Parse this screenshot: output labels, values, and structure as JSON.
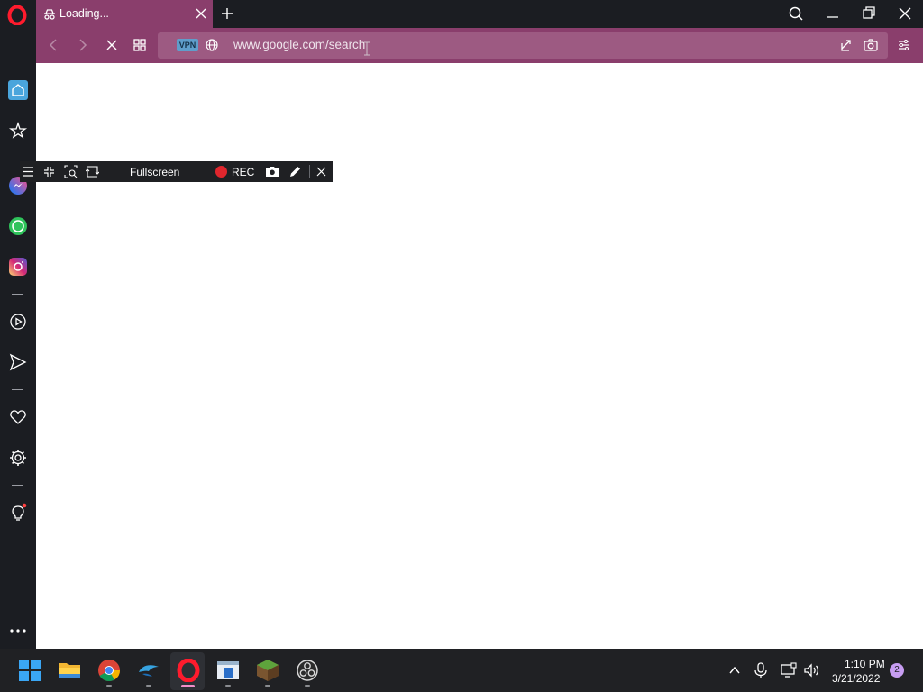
{
  "browser": {
    "tab": {
      "title": "Loading...",
      "icon": "incognito-icon"
    },
    "address": {
      "url": "www.google.com/search",
      "vpn_label": "VPN"
    },
    "window_controls": [
      "search-icon",
      "minimize-icon",
      "restore-icon",
      "close-icon"
    ],
    "nav": [
      "back-icon",
      "forward-icon",
      "stop-icon",
      "speed-dial-icon"
    ]
  },
  "sidebar": {
    "items": [
      "home-icon",
      "star-icon",
      "messenger-icon",
      "whatsapp-icon",
      "instagram-icon",
      "player-icon",
      "send-icon",
      "heart-icon",
      "settings-icon",
      "lightbulb-icon",
      "more-icon"
    ]
  },
  "capture_toolbar": {
    "fullscreen_label": "Fullscreen",
    "rec_label": "REC"
  },
  "taskbar": {
    "apps": [
      "windows-start-icon",
      "file-explorer-icon",
      "chrome-icon",
      "dolphin-icon",
      "opera-icon",
      "app-window-icon",
      "minecraft-icon",
      "obs-icon"
    ],
    "time": "1:10 PM",
    "date": "3/21/2022",
    "notification_count": "2"
  },
  "colors": {
    "accent": "#8a3e6c",
    "dark": "#1b1d22",
    "rec": "#e0262d"
  }
}
